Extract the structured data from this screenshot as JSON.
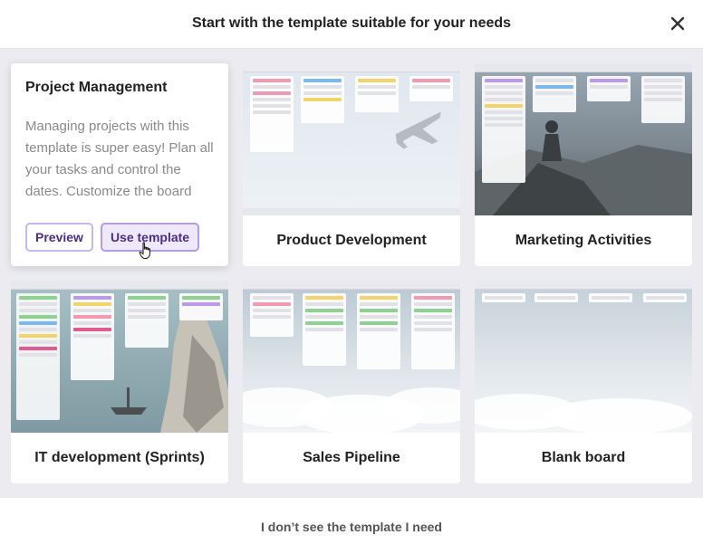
{
  "header": {
    "title": "Start with the template suitable for your needs"
  },
  "expanded": {
    "title": "Project Management",
    "description": "Managing projects with this template is super easy! Plan all your tasks and control the dates. Customize the board",
    "preview_label": "Preview",
    "use_label": "Use template"
  },
  "templates": [
    {
      "name": "Product Development"
    },
    {
      "name": "Marketing Activities"
    },
    {
      "name": "IT development (Sprints)"
    },
    {
      "name": "Sales Pipeline"
    },
    {
      "name": "Blank board"
    }
  ],
  "footer": {
    "link": "I don’t see the template I need"
  }
}
